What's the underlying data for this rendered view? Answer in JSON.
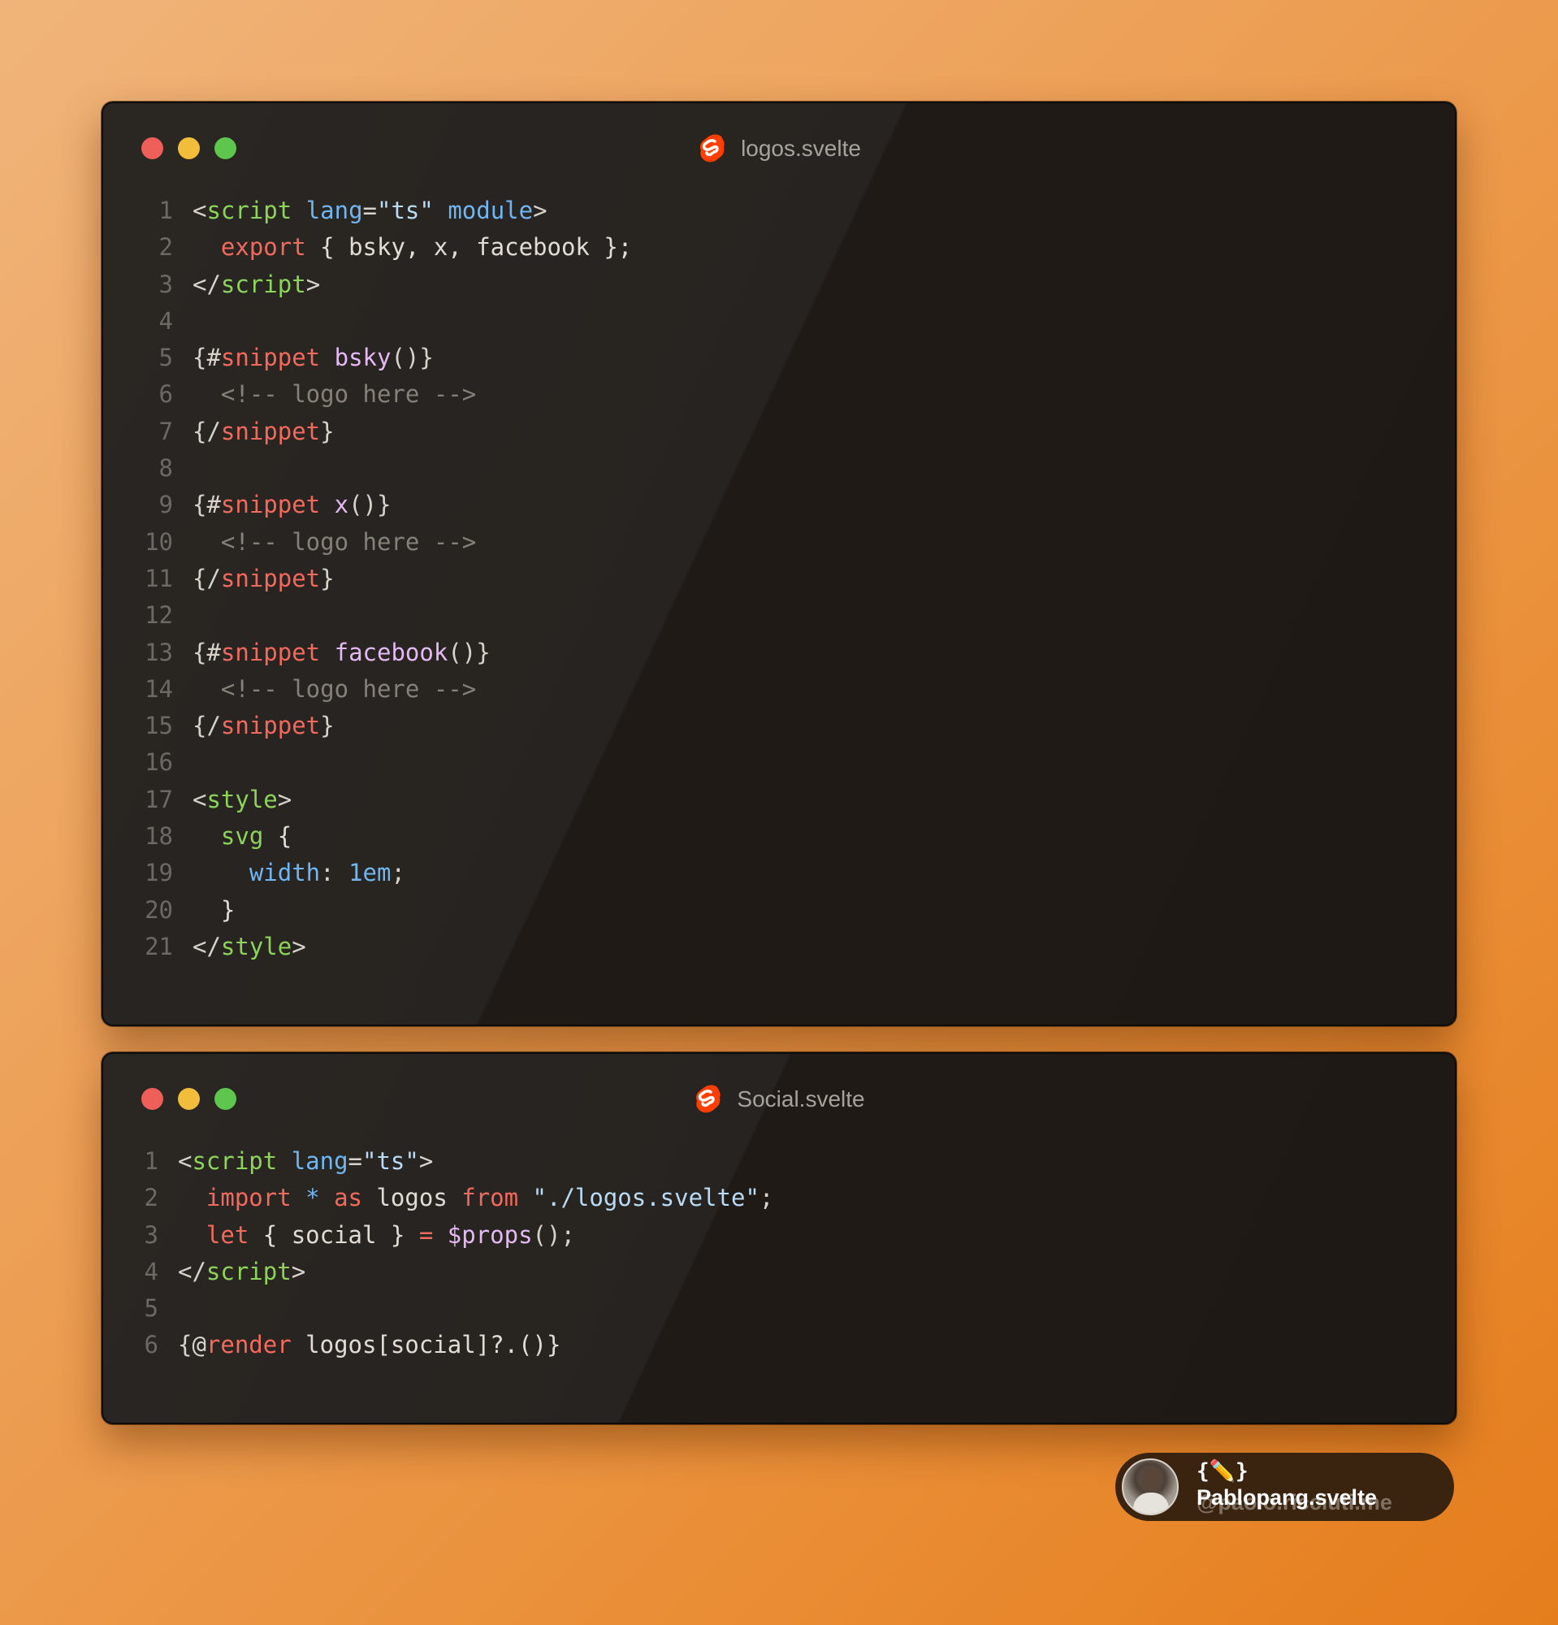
{
  "windows": [
    {
      "filename": "logos.svelte",
      "lines": [
        {
          "n": "1",
          "tokens": [
            [
              "tag-p",
              "<"
            ],
            [
              "tag",
              "script"
            ],
            [
              "plain",
              " "
            ],
            [
              "attr",
              "lang"
            ],
            [
              "punc",
              "="
            ],
            [
              "str",
              "\"ts\""
            ],
            [
              "plain",
              " "
            ],
            [
              "attr",
              "module"
            ],
            [
              "tag-p",
              ">"
            ]
          ]
        },
        {
          "n": "2",
          "tokens": [
            [
              "plain",
              "  "
            ],
            [
              "kw",
              "export"
            ],
            [
              "plain",
              " { bsky, x, facebook };"
            ]
          ]
        },
        {
          "n": "3",
          "tokens": [
            [
              "tag-p",
              "</"
            ],
            [
              "tag",
              "script"
            ],
            [
              "tag-p",
              ">"
            ]
          ]
        },
        {
          "n": "4",
          "tokens": []
        },
        {
          "n": "5",
          "tokens": [
            [
              "punc",
              "{#"
            ],
            [
              "kw",
              "snippet"
            ],
            [
              "plain",
              " "
            ],
            [
              "fn",
              "bsky"
            ],
            [
              "punc",
              "()}"
            ]
          ]
        },
        {
          "n": "6",
          "tokens": [
            [
              "plain",
              "  "
            ],
            [
              "cmt",
              "<!-- logo here -->"
            ]
          ]
        },
        {
          "n": "7",
          "tokens": [
            [
              "punc",
              "{/"
            ],
            [
              "kw",
              "snippet"
            ],
            [
              "punc",
              "}"
            ]
          ]
        },
        {
          "n": "8",
          "tokens": []
        },
        {
          "n": "9",
          "tokens": [
            [
              "punc",
              "{#"
            ],
            [
              "kw",
              "snippet"
            ],
            [
              "plain",
              " "
            ],
            [
              "fn",
              "x"
            ],
            [
              "punc",
              "()}"
            ]
          ]
        },
        {
          "n": "10",
          "tokens": [
            [
              "plain",
              "  "
            ],
            [
              "cmt",
              "<!-- logo here -->"
            ]
          ]
        },
        {
          "n": "11",
          "tokens": [
            [
              "punc",
              "{/"
            ],
            [
              "kw",
              "snippet"
            ],
            [
              "punc",
              "}"
            ]
          ]
        },
        {
          "n": "12",
          "tokens": []
        },
        {
          "n": "13",
          "tokens": [
            [
              "punc",
              "{#"
            ],
            [
              "kw",
              "snippet"
            ],
            [
              "plain",
              " "
            ],
            [
              "fn",
              "facebook"
            ],
            [
              "punc",
              "()}"
            ]
          ]
        },
        {
          "n": "14",
          "tokens": [
            [
              "plain",
              "  "
            ],
            [
              "cmt",
              "<!-- logo here -->"
            ]
          ]
        },
        {
          "n": "15",
          "tokens": [
            [
              "punc",
              "{/"
            ],
            [
              "kw",
              "snippet"
            ],
            [
              "punc",
              "}"
            ]
          ]
        },
        {
          "n": "16",
          "tokens": []
        },
        {
          "n": "17",
          "tokens": [
            [
              "tag-p",
              "<"
            ],
            [
              "tag",
              "style"
            ],
            [
              "tag-p",
              ">"
            ]
          ]
        },
        {
          "n": "18",
          "tokens": [
            [
              "plain",
              "  "
            ],
            [
              "tag",
              "svg"
            ],
            [
              "plain",
              " {"
            ]
          ]
        },
        {
          "n": "19",
          "tokens": [
            [
              "plain",
              "    "
            ],
            [
              "attr",
              "width"
            ],
            [
              "punc",
              ": "
            ],
            [
              "num",
              "1em"
            ],
            [
              "punc",
              ";"
            ]
          ]
        },
        {
          "n": "20",
          "tokens": [
            [
              "plain",
              "  }"
            ]
          ]
        },
        {
          "n": "21",
          "tokens": [
            [
              "tag-p",
              "</"
            ],
            [
              "tag",
              "style"
            ],
            [
              "tag-p",
              ">"
            ]
          ]
        }
      ]
    },
    {
      "filename": "Social.svelte",
      "lines": [
        {
          "n": "1",
          "tokens": [
            [
              "tag-p",
              "<"
            ],
            [
              "tag",
              "script"
            ],
            [
              "plain",
              " "
            ],
            [
              "attr",
              "lang"
            ],
            [
              "punc",
              "="
            ],
            [
              "str",
              "\"ts\""
            ],
            [
              "tag-p",
              ">"
            ]
          ]
        },
        {
          "n": "2",
          "tokens": [
            [
              "plain",
              "  "
            ],
            [
              "kw",
              "import"
            ],
            [
              "plain",
              " "
            ],
            [
              "attr",
              "*"
            ],
            [
              "plain",
              " "
            ],
            [
              "kw",
              "as"
            ],
            [
              "plain",
              " logos "
            ],
            [
              "kw",
              "from"
            ],
            [
              "plain",
              " "
            ],
            [
              "str",
              "\"./logos.svelte\""
            ],
            [
              "punc",
              ";"
            ]
          ]
        },
        {
          "n": "3",
          "tokens": [
            [
              "plain",
              "  "
            ],
            [
              "kw",
              "let"
            ],
            [
              "plain",
              " { social } "
            ],
            [
              "kw",
              "="
            ],
            [
              "plain",
              " "
            ],
            [
              "fn",
              "$props"
            ],
            [
              "punc",
              "();"
            ]
          ]
        },
        {
          "n": "4",
          "tokens": [
            [
              "tag-p",
              "</"
            ],
            [
              "tag",
              "script"
            ],
            [
              "tag-p",
              ">"
            ]
          ]
        },
        {
          "n": "5",
          "tokens": []
        },
        {
          "n": "6",
          "tokens": [
            [
              "punc",
              "{@"
            ],
            [
              "kw",
              "render"
            ],
            [
              "plain",
              " logos[social]?.()}"
            ]
          ]
        }
      ]
    }
  ],
  "badge": {
    "emoji_braces": "{✏️}",
    "name": "Pablopang.svelte",
    "handle": "@paolo.ricciuti.me"
  },
  "icons": {
    "window_controls": [
      "close-dot",
      "minimize-dot",
      "maximize-dot"
    ],
    "file_icon": "svelte-logo-icon"
  },
  "colors": {
    "svelte_orange": "#ff3e00",
    "close": "#ee5f5a",
    "minimize": "#f2bd3a",
    "maximize": "#5ec54d"
  }
}
